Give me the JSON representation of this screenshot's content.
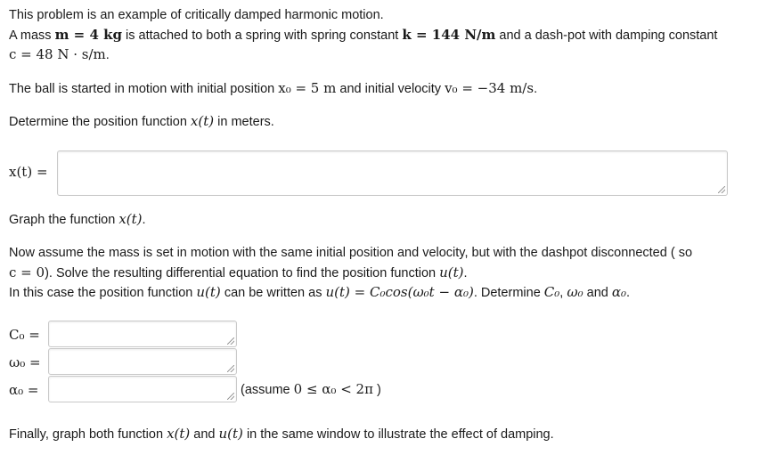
{
  "problem": {
    "intro": "This problem is an example of critically damped harmonic motion.",
    "line2_a": "A mass ",
    "line2_m": "m = 4 kg",
    "line2_b": " is attached to both a spring with spring constant ",
    "line2_k": "k = 144 N/m",
    "line2_c": " and a dash-pot with damping constant",
    "line3_c": "c = 48 N · s/m",
    "line3_end": ".",
    "line4_a": "The ball is started in motion with initial position ",
    "line4_x0": "x₀ = 5 m",
    "line4_b": " and initial velocity ",
    "line4_v0": "v₀ = −34 m/s",
    "line4_end": ".",
    "line5_a": "Determine the position function ",
    "line5_x": "x(t)",
    "line5_b": " in meters."
  },
  "answer_x": {
    "label": "x(t) =",
    "value": ""
  },
  "graph1": {
    "a": "Graph the function ",
    "x": "x(t)",
    "end": "."
  },
  "part2": {
    "p1_a": "Now assume the mass is set in motion with the same initial position and velocity, but with the dashpot disconnected ( so",
    "p2_c": "c = 0",
    "p2_a": "). Solve the resulting differential equation to find the position function ",
    "p2_u": "u(t)",
    "p2_end": ".",
    "p3_a": "In this case the position function ",
    "p3_u": "u(t)",
    "p3_b": " can be written as ",
    "p3_eq": "u(t) = C₀cos(ω₀t − α₀)",
    "p3_c": ". Determine ",
    "p3_C0": "C₀",
    "p3_comma": ", ",
    "p3_w0": "ω₀",
    "p3_and": " and ",
    "p3_a0": "α₀",
    "p3_end": "."
  },
  "answers": {
    "C0_label": "C₀ =",
    "w0_label": "ω₀ =",
    "a0_label": "α₀ =",
    "C0_value": "",
    "w0_value": "",
    "a0_value": "",
    "assume_a": "(assume ",
    "assume_math": "0 ≤ α₀ < 2π",
    "assume_b": " )"
  },
  "final": {
    "a": "Finally, graph both function ",
    "x": "x(t)",
    "b": " and ",
    "u": "u(t)",
    "c": " in the same window to illustrate the effect of damping."
  }
}
